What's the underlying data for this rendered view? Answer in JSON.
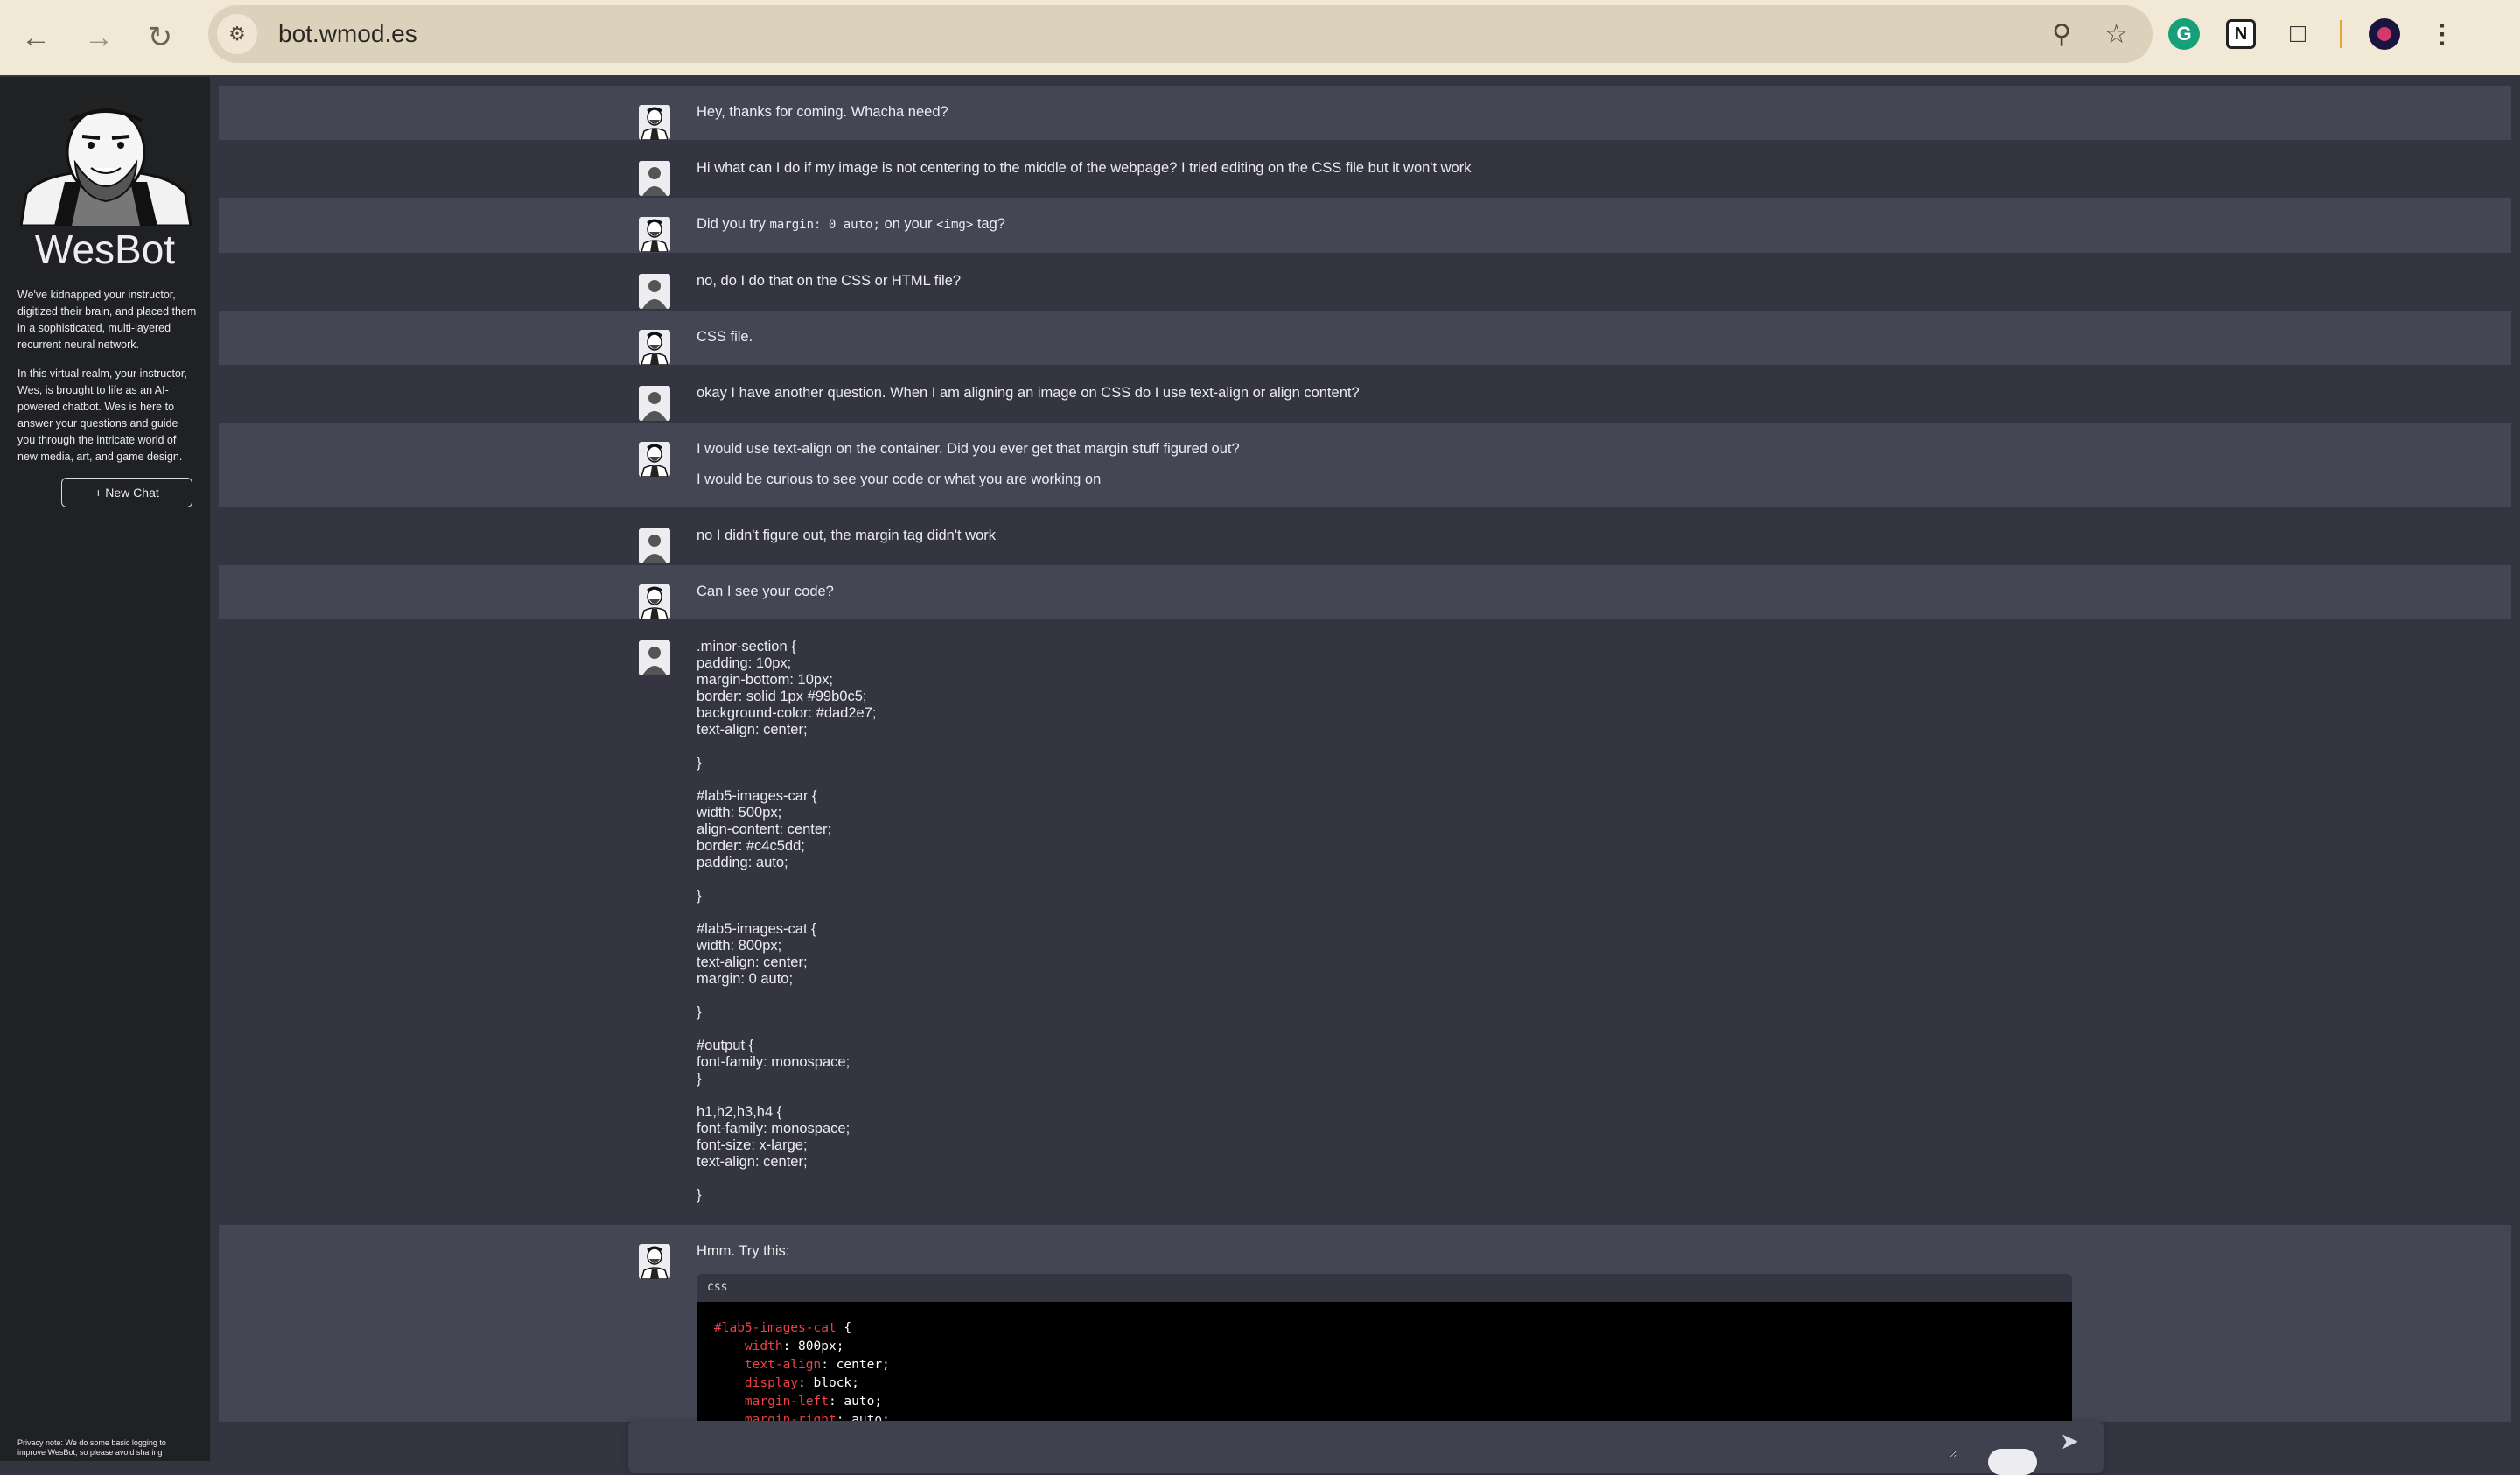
{
  "browser": {
    "url": "bot.wmod.es"
  },
  "sidebar": {
    "bot_name": "WesBot",
    "about_1": "We've kidnapped your instructor, digitized their brain, and placed them in a sophisticated, multi-layered recurrent neural network.",
    "about_2": "In this virtual realm, your instructor, Wes, is brought to life as an AI-powered chatbot. Wes is here to answer your questions and guide you through the intricate world of new media, art, and game design.",
    "new_chat_label": "+ New Chat",
    "privacy_note": "Privacy note: We do some basic logging to improve WesBot, so please avoid sharing"
  },
  "messages": {
    "m1": "Hey, thanks for coming. Whacha need?",
    "m2": "Hi what can I do if my image is not centering to the middle of the webpage? I tried editing on the CSS file but it won't work",
    "m3": {
      "before": "Did you try ",
      "code1": "margin: 0 auto;",
      "middle": " on your ",
      "code2": "<img>",
      "after": " tag?"
    },
    "m4": "no, do I do that on the CSS or HTML file?",
    "m5": "CSS file.",
    "m6": "okay I have another question. When I am aligning an image on CSS do I use text-align or align content?",
    "m7_p1": "I would use text-align on the container. Did you ever get that margin stuff figured out?",
    "m7_p2": "I would be curious to see your code or what you are working on",
    "m8": "no I didn't figure out, the margin tag didn't work",
    "m9": "Can I see your code?",
    "m10_lines": [
      ".minor-section {",
      "padding: 10px;",
      "margin-bottom: 10px;",
      "border: solid 1px #99b0c5;",
      "background-color: #dad2e7;",
      "text-align: center;",
      "",
      "}",
      "",
      "#lab5-images-car {",
      "width: 500px;",
      "align-content: center;",
      "border: #c4c5dd;",
      "padding: auto;",
      "",
      "}",
      "",
      "#lab5-images-cat {",
      "width: 800px;",
      "text-align: center;",
      "margin: 0 auto;",
      "",
      "}",
      "",
      "#output {",
      "font-family: monospace;",
      "}",
      "",
      "h1,h2,h3,h4 {",
      "font-family: monospace;",
      "font-size: x-large;",
      "text-align: center;",
      "",
      "}"
    ],
    "m11": "Hmm. Try this:",
    "code_lang": "css",
    "code": {
      "selector": "#lab5-images-cat",
      "open": " {",
      "decls": [
        {
          "prop": "width",
          "val": "800px"
        },
        {
          "prop": "text-align",
          "val": "center"
        },
        {
          "prop": "display",
          "val": "block"
        },
        {
          "prop": "margin-left",
          "val": "auto"
        },
        {
          "prop": "margin-right",
          "val": "auto"
        }
      ]
    }
  },
  "input": {
    "placeholder": ""
  }
}
